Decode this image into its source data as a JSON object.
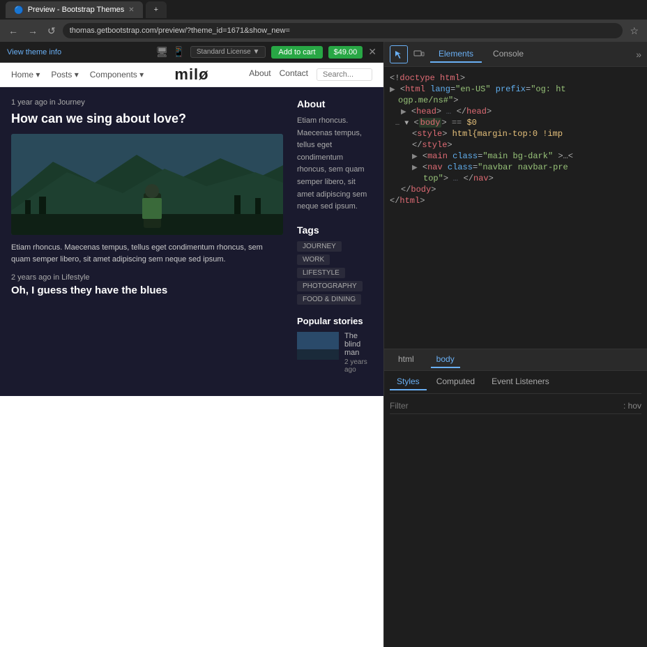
{
  "browser": {
    "tabs": [
      {
        "label": "Preview - Bootstrap Themes",
        "active": true
      },
      {
        "label": "",
        "active": false
      }
    ],
    "url": "thomas.getbootstrap.com/preview/?theme_id=1671&show_new="
  },
  "theme_bar": {
    "view_info": "View theme info",
    "license": "Standard License ▼",
    "add_to_cart": "Add to cart",
    "price": "$49.00"
  },
  "website": {
    "nav": {
      "links": [
        "Home ▾",
        "Posts ▾",
        "Components ▾"
      ],
      "logo": "milø",
      "right_links": [
        "About",
        "Contact"
      ],
      "search_placeholder": "Search..."
    },
    "article1": {
      "meta": "1 year ago in Journey",
      "title": "How can we sing about love?",
      "excerpt": "Etiam rhoncus. Maecenas tempus, tellus eget condimentum rhoncus, sem quam semper libero, sit amet adipiscing sem neque sed ipsum."
    },
    "article2": {
      "meta": "2 years ago in Lifestyle",
      "title": "Oh, I guess they have the blues"
    },
    "sidebar": {
      "about_title": "About",
      "about_text": "Etiam rhoncus. Maecenas tempus, tellus eget condimentum rhoncus, sem quam semper libero, sit amet adipiscing sem neque sed ipsum.",
      "tags_title": "Tags",
      "tags": [
        "JOURNEY",
        "WORK",
        "LIFESTYLE",
        "PHOTOGRAPHY",
        "FOOD & DINING"
      ],
      "popular_title": "Popular stories",
      "popular_items": [
        {
          "title": "The blind man",
          "meta": "2 years ago"
        }
      ]
    }
  },
  "devtools": {
    "tabs": [
      "Elements",
      "Console"
    ],
    "html_tree": {
      "doctype": "<!doctype html>",
      "html_open": "<html lang=\"en-US\" prefix=\"og: ht",
      "html_cont": "ogp.me/ns#\">",
      "head": "<head>…</head>",
      "body_open": "<body>",
      "body_eq": "== $0",
      "style_open": "<style>html{margin-top:0 !imp",
      "style_close": "</style>",
      "main_open": "<main class=\"main bg-dark\">…<",
      "nav_open": "<nav class=\"navbar navbar-pre",
      "nav_mid": "top\">…</nav>",
      "body_close": "</body>",
      "html_close": "</html>"
    },
    "bottom_tabs": [
      "html",
      "body"
    ],
    "styles_tabs": [
      "Styles",
      "Computed",
      "Event Listeners"
    ],
    "filter_placeholder": "Filter",
    "filter_hov": ": hov"
  }
}
